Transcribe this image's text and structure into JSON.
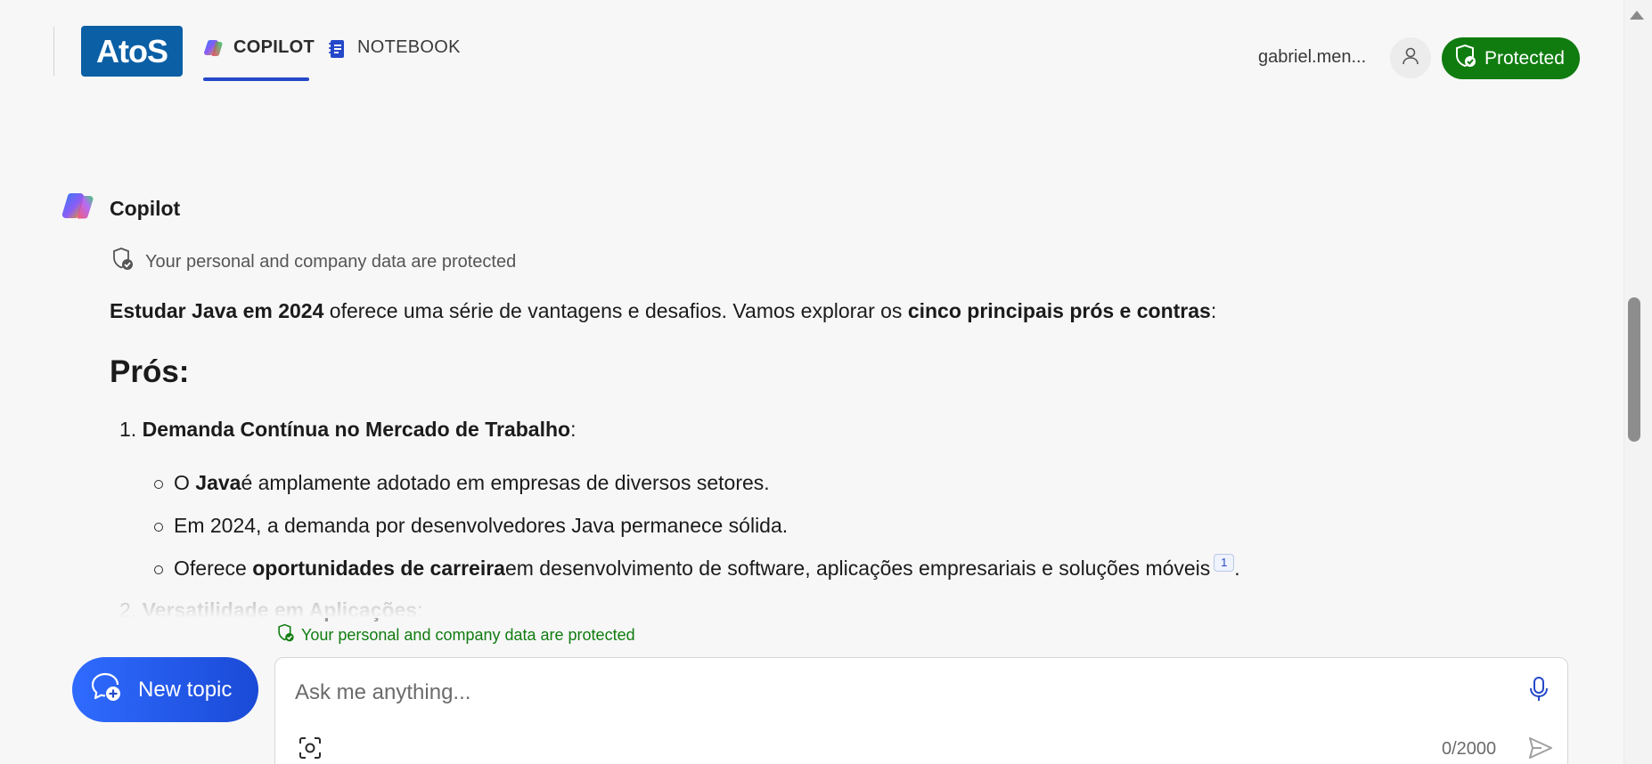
{
  "header": {
    "logo_text": "AtoS",
    "tabs": [
      {
        "label": "COPILOT",
        "active": true,
        "icon": "copilot-icon"
      },
      {
        "label": "NOTEBOOK",
        "active": false,
        "icon": "notebook-icon"
      }
    ],
    "user_name": "gabriel.men...",
    "avatar_icon": "user-icon",
    "protected_label": "Protected",
    "protected_icon": "shield-check-icon"
  },
  "colors": {
    "accent_blue": "#2448c9",
    "protected_green": "#107c10",
    "logo_blue": "#0b5fa5",
    "new_topic_blue": "#2f6bff"
  },
  "message": {
    "author": "Copilot",
    "author_icon": "copilot-icon",
    "privacy_notice": "Your personal and company data are protected",
    "intro": {
      "bold_1": "Estudar Java em 2024",
      "text_1": " oferece uma série de vantagens e desafios. Vamos explorar os ",
      "bold_2": "cinco principais prós e contras",
      "text_2": ":"
    },
    "heading": "Prós:",
    "items": [
      {
        "number": "1.",
        "title": "Demanda Contínua no Mercado de Trabalho",
        "suffix": ":",
        "bullets": [
          {
            "pre": "O ",
            "bold": "Java",
            "post": " é amplamente adotado em empresas de diversos setores."
          },
          {
            "pre": "Em 2024, a demanda por desenvolvedores Java permanece sólida.",
            "bold": "",
            "post": ""
          },
          {
            "pre": "Oferece ",
            "bold": "oportunidades de carreira",
            "post": " em desenvolvimento de software, aplicações empresariais e soluções móveis",
            "citation": "1",
            "end": "."
          }
        ]
      },
      {
        "number": "2.",
        "title": "Versatilidade em Aplicações",
        "suffix": ":"
      }
    ]
  },
  "composer": {
    "privacy_notice": "Your personal and company data are protected",
    "new_topic_label": "New topic",
    "new_topic_icon": "chat-add-icon",
    "placeholder": "Ask me anything...",
    "value": "",
    "char_count": "0/2000",
    "mic_icon": "microphone-icon",
    "screenshot_icon": "screenshot-capture-icon",
    "send_icon": "send-icon"
  },
  "scrollbar": {
    "position_fraction": 0.46
  }
}
